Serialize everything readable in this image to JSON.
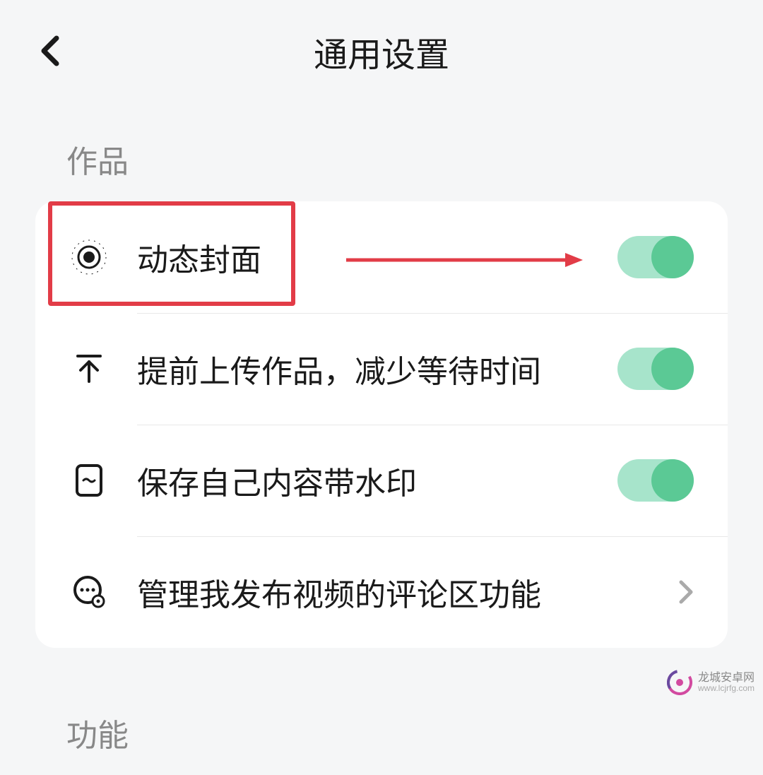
{
  "header": {
    "title": "通用设置"
  },
  "sections": {
    "works": {
      "title": "作品",
      "items": {
        "dynamic_cover": {
          "label": "动态封面",
          "toggle_on": true
        },
        "pre_upload": {
          "label": "提前上传作品，减少等待时间",
          "toggle_on": true
        },
        "save_watermark": {
          "label": "保存自己内容带水印",
          "toggle_on": true
        },
        "manage_comments": {
          "label": "管理我发布视频的评论区功能"
        }
      }
    },
    "functions": {
      "title": "功能"
    }
  },
  "watermark": {
    "title": "龙城安卓网",
    "url": "www.lcjrfg.com"
  },
  "colors": {
    "toggle_on_track": "#a7e4cb",
    "toggle_on_knob": "#5bc995",
    "highlight": "#e23c47"
  }
}
